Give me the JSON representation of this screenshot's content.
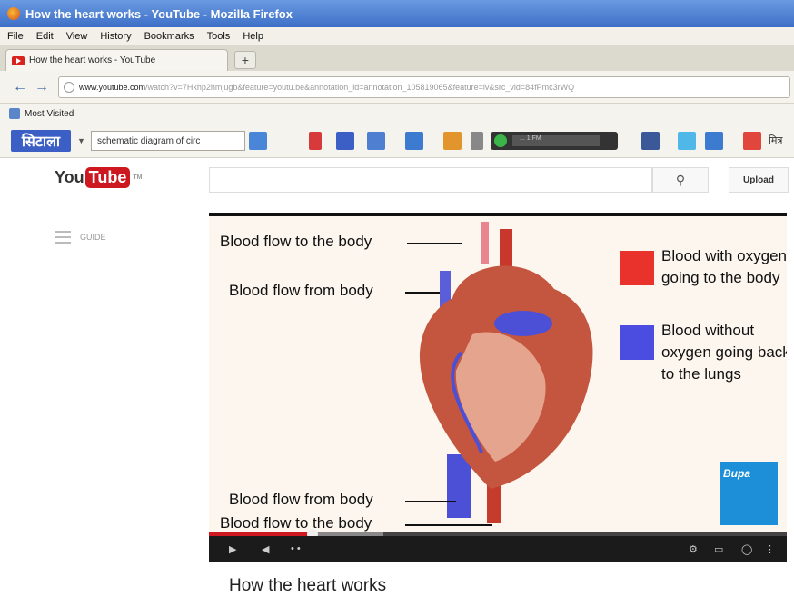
{
  "browser": {
    "window_title": "How the heart works - YouTube - Mozilla Firefox",
    "menu": [
      "File",
      "Edit",
      "View",
      "History",
      "Bookmarks",
      "Tools",
      "Help"
    ],
    "tab_label": "How the heart works - YouTube",
    "new_tab_symbol": "+",
    "url_domain": "www.youtube.com",
    "url_rest": "/watch?v=7Hkhp2hmjugb&feature=youtu.be&annotation_id=annotation_105819065&feature=iv&src_vid=84fPmc3rWQ",
    "bookmarks_label": "Most Visited"
  },
  "addon_toolbar": {
    "brand_label": "सिटाला",
    "search_text": "schematic diagram of circ",
    "player_field": "... 1.FM",
    "hindi_label": "मित्र"
  },
  "youtube": {
    "logo_you": "You",
    "logo_tube": "Tube",
    "logo_tm": "TM",
    "search_icon": "search-icon",
    "upload_label": "Upload",
    "guide_label": "GUIDE"
  },
  "video": {
    "labels": {
      "flow_to_body_top": "Blood flow to the body",
      "flow_from_body_top": "Blood flow from body",
      "flow_from_body_bottom": "Blood flow from body",
      "flow_to_body_bottom": "Blood flow to the body"
    },
    "legend": [
      {
        "color": "#e8322b",
        "text": "Blood with oxygen going to the body"
      },
      {
        "color": "#4a4de0",
        "text": "Blood without oxygen going back to the lungs"
      }
    ],
    "bupa_logo": "Bupa",
    "progress_fraction": 0.18
  },
  "page": {
    "video_title": "How the heart works"
  }
}
